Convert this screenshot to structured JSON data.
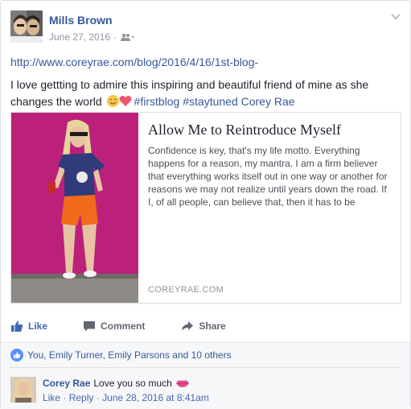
{
  "post": {
    "author": "Mills Brown",
    "date": "June 27, 2016",
    "audience_icon": "friends-icon",
    "link": "http://www.coreyrae.com/blog/2016/4/16/1st-blog-",
    "text_main": "I love gettting to admire this inspiring and beautiful friend of mine as she changes the world ",
    "hashtags": "#firstblog #staytuned",
    "tagged_name": "Corey Rae"
  },
  "shared_link": {
    "title": "Allow Me to Reintroduce Myself",
    "description": "Confidence is key, that's my life motto. Everything happens for a reason, my mantra. I am a firm believer that everything works itself out in one way or another for reasons we may not realize until years down the road. If I, of all people, can believe that, then it has to be",
    "domain": "COREYRAE.COM"
  },
  "actions": {
    "like": "Like",
    "comment": "Comment",
    "share": "Share"
  },
  "reactions": {
    "names": "You, Emily Turner, Emily Parsons and 10 others"
  },
  "comment": {
    "author": "Corey Rae",
    "text": "Love you so much",
    "like": "Like",
    "separator": "·",
    "reply": "Reply",
    "timestamp": "June 28, 2016 at 8:41am"
  },
  "colors": {
    "link_blue": "#365899",
    "like_blue": "#4267b2",
    "image_bg": "#b61e77"
  }
}
